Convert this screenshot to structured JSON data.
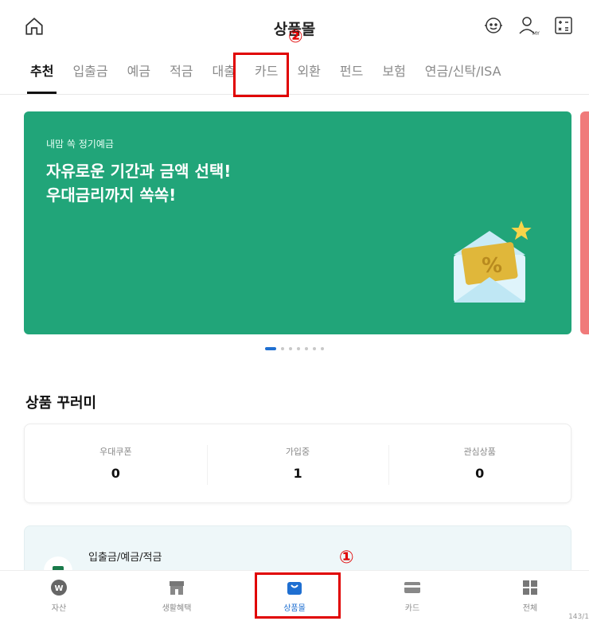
{
  "header": {
    "title": "상품몰",
    "icons": [
      "home-icon",
      "chatbot-icon",
      "my-profile-icon",
      "calculator-icon"
    ]
  },
  "tabs": [
    {
      "label": "추천"
    },
    {
      "label": "입출금"
    },
    {
      "label": "예금"
    },
    {
      "label": "적금"
    },
    {
      "label": "대출"
    },
    {
      "label": "카드"
    },
    {
      "label": "외환"
    },
    {
      "label": "펀드"
    },
    {
      "label": "보험"
    },
    {
      "label": "연금/신탁/ISA"
    }
  ],
  "banner": {
    "subtitle": "내맘 쏙 정기예금",
    "title_line1": "자유로운 기간과 금액 선택!",
    "title_line2": "우대금리까지 쏙쏙!",
    "bg_color": "#21a579"
  },
  "carousel": {
    "total": 7,
    "active": 1
  },
  "section": {
    "title": "상품 꾸러미",
    "stats": [
      {
        "label": "우대쿠폰",
        "value": "0"
      },
      {
        "label": "가입중",
        "value": "1"
      },
      {
        "label": "관심상품",
        "value": "0"
      }
    ]
  },
  "category": {
    "title": "입출금/예금/적금"
  },
  "bottom_nav": {
    "items": [
      {
        "label": "자산",
        "icon": "asset-icon"
      },
      {
        "label": "생활혜택",
        "icon": "store-icon"
      },
      {
        "label": "상품몰",
        "icon": "shopping-bag-icon"
      },
      {
        "label": "카드",
        "icon": "card-icon"
      },
      {
        "label": "전체",
        "icon": "menu-grid-icon"
      }
    ],
    "active": "상품몰"
  },
  "page_indicator": "143/1",
  "annotations": [
    {
      "number": "①",
      "target": "상품몰"
    },
    {
      "number": "②",
      "target": "대출"
    }
  ],
  "colors": {
    "accent": "#1f6fd1",
    "highlight": "#e00000",
    "banner": "#21a579"
  }
}
